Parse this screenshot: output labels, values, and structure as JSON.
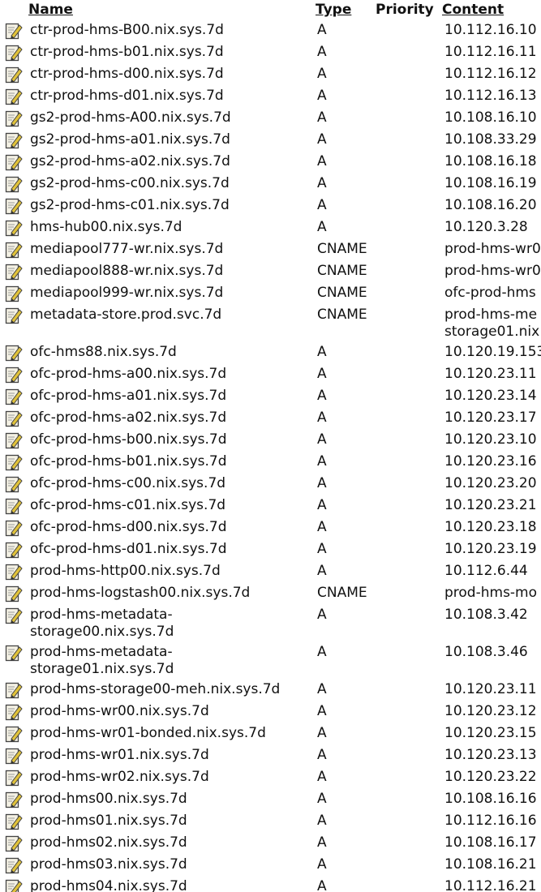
{
  "columns": {
    "name": "Name",
    "type": "Type",
    "priority": "Priority",
    "content": "Content"
  },
  "icon_colors": {
    "paper": "#f4f1e4",
    "border": "#444444",
    "pencil": "#e0c23a",
    "pencil_tip": "#333333"
  },
  "records": [
    {
      "name": "ctr-prod-hms-B00.nix.sys.7d",
      "type": "A",
      "priority": "",
      "content": "10.112.16.10"
    },
    {
      "name": "ctr-prod-hms-b01.nix.sys.7d",
      "type": "A",
      "priority": "",
      "content": "10.112.16.11"
    },
    {
      "name": "ctr-prod-hms-d00.nix.sys.7d",
      "type": "A",
      "priority": "",
      "content": "10.112.16.12"
    },
    {
      "name": "ctr-prod-hms-d01.nix.sys.7d",
      "type": "A",
      "priority": "",
      "content": "10.112.16.13"
    },
    {
      "name": "gs2-prod-hms-A00.nix.sys.7d",
      "type": "A",
      "priority": "",
      "content": "10.108.16.10"
    },
    {
      "name": "gs2-prod-hms-a01.nix.sys.7d",
      "type": "A",
      "priority": "",
      "content": "10.108.33.29"
    },
    {
      "name": "gs2-prod-hms-a02.nix.sys.7d",
      "type": "A",
      "priority": "",
      "content": "10.108.16.18"
    },
    {
      "name": "gs2-prod-hms-c00.nix.sys.7d",
      "type": "A",
      "priority": "",
      "content": "10.108.16.19"
    },
    {
      "name": "gs2-prod-hms-c01.nix.sys.7d",
      "type": "A",
      "priority": "",
      "content": "10.108.16.20"
    },
    {
      "name": "hms-hub00.nix.sys.7d",
      "type": "A",
      "priority": "",
      "content": "10.120.3.28"
    },
    {
      "name": "mediapool777-wr.nix.sys.7d",
      "type": "CNAME",
      "priority": "",
      "content": "prod-hms-wr0"
    },
    {
      "name": "mediapool888-wr.nix.sys.7d",
      "type": "CNAME",
      "priority": "",
      "content": "prod-hms-wr0"
    },
    {
      "name": "mediapool999-wr.nix.sys.7d",
      "type": "CNAME",
      "priority": "",
      "content": "ofc-prod-hms"
    },
    {
      "name": "metadata-store.prod.svc.7d",
      "type": "CNAME",
      "priority": "",
      "content": "prod-hms-me",
      "content2": "storage01.nix"
    },
    {
      "name": "ofc-hms88.nix.sys.7d",
      "type": "A",
      "priority": "",
      "content": "10.120.19.153"
    },
    {
      "name": "ofc-prod-hms-a00.nix.sys.7d",
      "type": "A",
      "priority": "",
      "content": "10.120.23.11"
    },
    {
      "name": "ofc-prod-hms-a01.nix.sys.7d",
      "type": "A",
      "priority": "",
      "content": "10.120.23.14"
    },
    {
      "name": "ofc-prod-hms-a02.nix.sys.7d",
      "type": "A",
      "priority": "",
      "content": "10.120.23.17"
    },
    {
      "name": "ofc-prod-hms-b00.nix.sys.7d",
      "type": "A",
      "priority": "",
      "content": "10.120.23.10"
    },
    {
      "name": "ofc-prod-hms-b01.nix.sys.7d",
      "type": "A",
      "priority": "",
      "content": "10.120.23.16"
    },
    {
      "name": "ofc-prod-hms-c00.nix.sys.7d",
      "type": "A",
      "priority": "",
      "content": "10.120.23.20"
    },
    {
      "name": "ofc-prod-hms-c01.nix.sys.7d",
      "type": "A",
      "priority": "",
      "content": "10.120.23.21"
    },
    {
      "name": "ofc-prod-hms-d00.nix.sys.7d",
      "type": "A",
      "priority": "",
      "content": "10.120.23.18"
    },
    {
      "name": "ofc-prod-hms-d01.nix.sys.7d",
      "type": "A",
      "priority": "",
      "content": "10.120.23.19"
    },
    {
      "name": "prod-hms-http00.nix.sys.7d",
      "type": "A",
      "priority": "",
      "content": "10.112.6.44"
    },
    {
      "name": "prod-hms-logstash00.nix.sys.7d",
      "type": "CNAME",
      "priority": "",
      "content": "prod-hms-mo"
    },
    {
      "name": "prod-hms-metadata-",
      "name2": "storage00.nix.sys.7d",
      "type": "A",
      "priority": "",
      "content": "10.108.3.42"
    },
    {
      "name": "prod-hms-metadata-",
      "name2": "storage01.nix.sys.7d",
      "type": "A",
      "priority": "",
      "content": "10.108.3.46"
    },
    {
      "name": "prod-hms-storage00-meh.nix.sys.7d",
      "type": "A",
      "priority": "",
      "content": "10.120.23.11"
    },
    {
      "name": "prod-hms-wr00.nix.sys.7d",
      "type": "A",
      "priority": "",
      "content": "10.120.23.12"
    },
    {
      "name": "prod-hms-wr01-bonded.nix.sys.7d",
      "type": "A",
      "priority": "",
      "content": "10.120.23.15"
    },
    {
      "name": "prod-hms-wr01.nix.sys.7d",
      "type": "A",
      "priority": "",
      "content": "10.120.23.13"
    },
    {
      "name": "prod-hms-wr02.nix.sys.7d",
      "type": "A",
      "priority": "",
      "content": "10.120.23.22"
    },
    {
      "name": "prod-hms00.nix.sys.7d",
      "type": "A",
      "priority": "",
      "content": "10.108.16.16"
    },
    {
      "name": "prod-hms01.nix.sys.7d",
      "type": "A",
      "priority": "",
      "content": "10.112.16.16"
    },
    {
      "name": "prod-hms02.nix.sys.7d",
      "type": "A",
      "priority": "",
      "content": "10.108.16.17"
    },
    {
      "name": "prod-hms03.nix.sys.7d",
      "type": "A",
      "priority": "",
      "content": "10.108.16.21"
    },
    {
      "name": "prod-hms04.nix.sys.7d",
      "type": "A",
      "priority": "",
      "content": "10.112.16.21"
    }
  ]
}
